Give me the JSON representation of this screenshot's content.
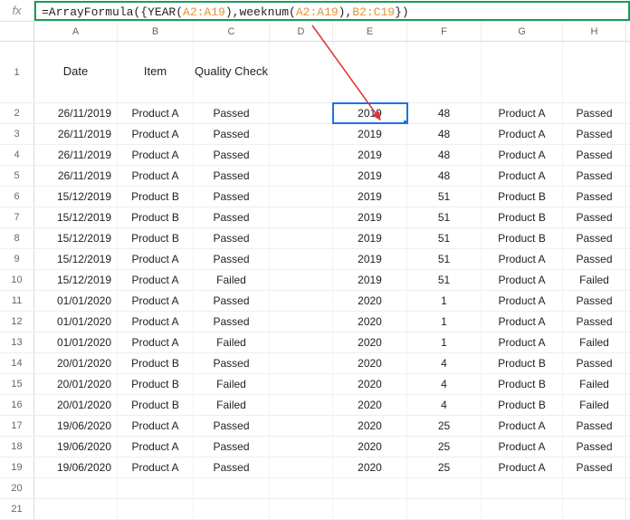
{
  "formula": {
    "prefix": "=ArrayFormula({YEAR(",
    "r1": "A2:A19",
    "mid1": "),weeknum(",
    "r2": "A2:A19",
    "mid2": "),",
    "r3": "B2:C19",
    "suffix": "})"
  },
  "columns": [
    "A",
    "B",
    "C",
    "D",
    "E",
    "F",
    "G",
    "H"
  ],
  "headerRow": {
    "A": "Date",
    "B": "Item",
    "C": "Quality Check"
  },
  "rows": [
    {
      "n": 2,
      "A": "26/11/2019",
      "B": "Product A",
      "C": "Passed",
      "E": "2019",
      "F": "48",
      "G": "Product A",
      "H": "Passed"
    },
    {
      "n": 3,
      "A": "26/11/2019",
      "B": "Product A",
      "C": "Passed",
      "E": "2019",
      "F": "48",
      "G": "Product A",
      "H": "Passed"
    },
    {
      "n": 4,
      "A": "26/11/2019",
      "B": "Product A",
      "C": "Passed",
      "E": "2019",
      "F": "48",
      "G": "Product A",
      "H": "Passed"
    },
    {
      "n": 5,
      "A": "26/11/2019",
      "B": "Product A",
      "C": "Passed",
      "E": "2019",
      "F": "48",
      "G": "Product A",
      "H": "Passed"
    },
    {
      "n": 6,
      "A": "15/12/2019",
      "B": "Product B",
      "C": "Passed",
      "E": "2019",
      "F": "51",
      "G": "Product B",
      "H": "Passed"
    },
    {
      "n": 7,
      "A": "15/12/2019",
      "B": "Product B",
      "C": "Passed",
      "E": "2019",
      "F": "51",
      "G": "Product B",
      "H": "Passed"
    },
    {
      "n": 8,
      "A": "15/12/2019",
      "B": "Product B",
      "C": "Passed",
      "E": "2019",
      "F": "51",
      "G": "Product B",
      "H": "Passed"
    },
    {
      "n": 9,
      "A": "15/12/2019",
      "B": "Product A",
      "C": "Passed",
      "E": "2019",
      "F": "51",
      "G": "Product A",
      "H": "Passed"
    },
    {
      "n": 10,
      "A": "15/12/2019",
      "B": "Product A",
      "C": "Failed",
      "E": "2019",
      "F": "51",
      "G": "Product A",
      "H": "Failed"
    },
    {
      "n": 11,
      "A": "01/01/2020",
      "B": "Product A",
      "C": "Passed",
      "E": "2020",
      "F": "1",
      "G": "Product A",
      "H": "Passed"
    },
    {
      "n": 12,
      "A": "01/01/2020",
      "B": "Product A",
      "C": "Passed",
      "E": "2020",
      "F": "1",
      "G": "Product A",
      "H": "Passed"
    },
    {
      "n": 13,
      "A": "01/01/2020",
      "B": "Product A",
      "C": "Failed",
      "E": "2020",
      "F": "1",
      "G": "Product A",
      "H": "Failed"
    },
    {
      "n": 14,
      "A": "20/01/2020",
      "B": "Product B",
      "C": "Passed",
      "E": "2020",
      "F": "4",
      "G": "Product B",
      "H": "Passed"
    },
    {
      "n": 15,
      "A": "20/01/2020",
      "B": "Product B",
      "C": "Failed",
      "E": "2020",
      "F": "4",
      "G": "Product B",
      "H": "Failed"
    },
    {
      "n": 16,
      "A": "20/01/2020",
      "B": "Product B",
      "C": "Failed",
      "E": "2020",
      "F": "4",
      "G": "Product B",
      "H": "Failed"
    },
    {
      "n": 17,
      "A": "19/06/2020",
      "B": "Product A",
      "C": "Passed",
      "E": "2020",
      "F": "25",
      "G": "Product A",
      "H": "Passed"
    },
    {
      "n": 18,
      "A": "19/06/2020",
      "B": "Product A",
      "C": "Passed",
      "E": "2020",
      "F": "25",
      "G": "Product A",
      "H": "Passed"
    },
    {
      "n": 19,
      "A": "19/06/2020",
      "B": "Product A",
      "C": "Passed",
      "E": "2020",
      "F": "25",
      "G": "Product A",
      "H": "Passed"
    },
    {
      "n": 20
    },
    {
      "n": 21
    }
  ],
  "activeCell": "E2"
}
